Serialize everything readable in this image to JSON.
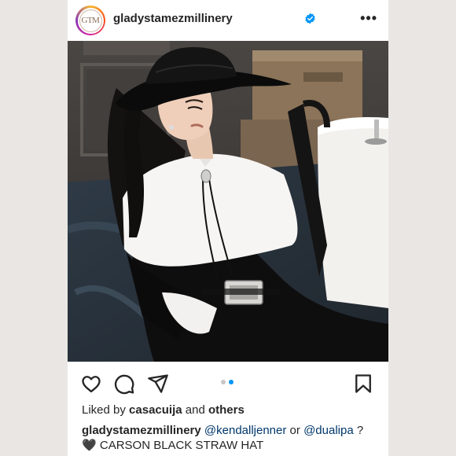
{
  "post": {
    "username": "gladystamezmillinery",
    "avatar_text": "GTM",
    "verified": true,
    "more_icon": "more-dots-icon"
  },
  "photo": {
    "carousel_total": 2,
    "carousel_active": 2
  },
  "actions": {
    "icons": [
      "heart-icon",
      "comment-icon",
      "share-icon",
      "bookmark-icon"
    ]
  },
  "likes": {
    "prefix": "Liked by",
    "user": "casacuija",
    "conj": "and",
    "others": "others"
  },
  "caption": {
    "username": "gladystamezmillinery",
    "mention1": "@kendalljenner",
    "or": "or",
    "mention2": "@dualipa",
    "qmark": "?",
    "heart": "🖤",
    "text": "CARSON BLACK STRAW HAT"
  },
  "colors": {
    "background": "#e9e6e3",
    "verified": "#0095f6",
    "active_dot": "#0095f6",
    "mention": "#00376b"
  }
}
